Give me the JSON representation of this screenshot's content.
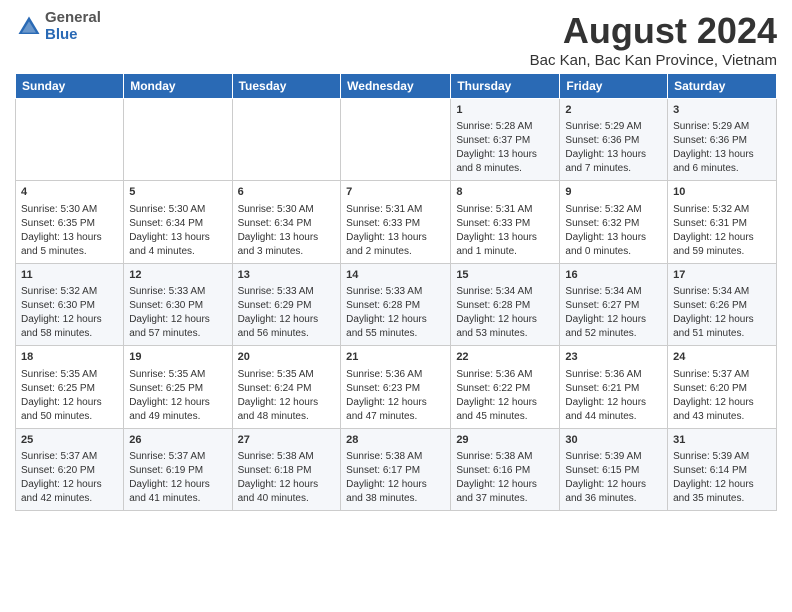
{
  "header": {
    "logo_general": "General",
    "logo_blue": "Blue",
    "title": "August 2024",
    "subtitle": "Bac Kan, Bac Kan Province, Vietnam"
  },
  "days_of_week": [
    "Sunday",
    "Monday",
    "Tuesday",
    "Wednesday",
    "Thursday",
    "Friday",
    "Saturday"
  ],
  "weeks": [
    [
      {
        "day": "",
        "content": ""
      },
      {
        "day": "",
        "content": ""
      },
      {
        "day": "",
        "content": ""
      },
      {
        "day": "",
        "content": ""
      },
      {
        "day": "1",
        "content": "Sunrise: 5:28 AM\nSunset: 6:37 PM\nDaylight: 13 hours\nand 8 minutes."
      },
      {
        "day": "2",
        "content": "Sunrise: 5:29 AM\nSunset: 6:36 PM\nDaylight: 13 hours\nand 7 minutes."
      },
      {
        "day": "3",
        "content": "Sunrise: 5:29 AM\nSunset: 6:36 PM\nDaylight: 13 hours\nand 6 minutes."
      }
    ],
    [
      {
        "day": "4",
        "content": "Sunrise: 5:30 AM\nSunset: 6:35 PM\nDaylight: 13 hours\nand 5 minutes."
      },
      {
        "day": "5",
        "content": "Sunrise: 5:30 AM\nSunset: 6:34 PM\nDaylight: 13 hours\nand 4 minutes."
      },
      {
        "day": "6",
        "content": "Sunrise: 5:30 AM\nSunset: 6:34 PM\nDaylight: 13 hours\nand 3 minutes."
      },
      {
        "day": "7",
        "content": "Sunrise: 5:31 AM\nSunset: 6:33 PM\nDaylight: 13 hours\nand 2 minutes."
      },
      {
        "day": "8",
        "content": "Sunrise: 5:31 AM\nSunset: 6:33 PM\nDaylight: 13 hours\nand 1 minute."
      },
      {
        "day": "9",
        "content": "Sunrise: 5:32 AM\nSunset: 6:32 PM\nDaylight: 13 hours\nand 0 minutes."
      },
      {
        "day": "10",
        "content": "Sunrise: 5:32 AM\nSunset: 6:31 PM\nDaylight: 12 hours\nand 59 minutes."
      }
    ],
    [
      {
        "day": "11",
        "content": "Sunrise: 5:32 AM\nSunset: 6:30 PM\nDaylight: 12 hours\nand 58 minutes."
      },
      {
        "day": "12",
        "content": "Sunrise: 5:33 AM\nSunset: 6:30 PM\nDaylight: 12 hours\nand 57 minutes."
      },
      {
        "day": "13",
        "content": "Sunrise: 5:33 AM\nSunset: 6:29 PM\nDaylight: 12 hours\nand 56 minutes."
      },
      {
        "day": "14",
        "content": "Sunrise: 5:33 AM\nSunset: 6:28 PM\nDaylight: 12 hours\nand 55 minutes."
      },
      {
        "day": "15",
        "content": "Sunrise: 5:34 AM\nSunset: 6:28 PM\nDaylight: 12 hours\nand 53 minutes."
      },
      {
        "day": "16",
        "content": "Sunrise: 5:34 AM\nSunset: 6:27 PM\nDaylight: 12 hours\nand 52 minutes."
      },
      {
        "day": "17",
        "content": "Sunrise: 5:34 AM\nSunset: 6:26 PM\nDaylight: 12 hours\nand 51 minutes."
      }
    ],
    [
      {
        "day": "18",
        "content": "Sunrise: 5:35 AM\nSunset: 6:25 PM\nDaylight: 12 hours\nand 50 minutes."
      },
      {
        "day": "19",
        "content": "Sunrise: 5:35 AM\nSunset: 6:25 PM\nDaylight: 12 hours\nand 49 minutes."
      },
      {
        "day": "20",
        "content": "Sunrise: 5:35 AM\nSunset: 6:24 PM\nDaylight: 12 hours\nand 48 minutes."
      },
      {
        "day": "21",
        "content": "Sunrise: 5:36 AM\nSunset: 6:23 PM\nDaylight: 12 hours\nand 47 minutes."
      },
      {
        "day": "22",
        "content": "Sunrise: 5:36 AM\nSunset: 6:22 PM\nDaylight: 12 hours\nand 45 minutes."
      },
      {
        "day": "23",
        "content": "Sunrise: 5:36 AM\nSunset: 6:21 PM\nDaylight: 12 hours\nand 44 minutes."
      },
      {
        "day": "24",
        "content": "Sunrise: 5:37 AM\nSunset: 6:20 PM\nDaylight: 12 hours\nand 43 minutes."
      }
    ],
    [
      {
        "day": "25",
        "content": "Sunrise: 5:37 AM\nSunset: 6:20 PM\nDaylight: 12 hours\nand 42 minutes."
      },
      {
        "day": "26",
        "content": "Sunrise: 5:37 AM\nSunset: 6:19 PM\nDaylight: 12 hours\nand 41 minutes."
      },
      {
        "day": "27",
        "content": "Sunrise: 5:38 AM\nSunset: 6:18 PM\nDaylight: 12 hours\nand 40 minutes."
      },
      {
        "day": "28",
        "content": "Sunrise: 5:38 AM\nSunset: 6:17 PM\nDaylight: 12 hours\nand 38 minutes."
      },
      {
        "day": "29",
        "content": "Sunrise: 5:38 AM\nSunset: 6:16 PM\nDaylight: 12 hours\nand 37 minutes."
      },
      {
        "day": "30",
        "content": "Sunrise: 5:39 AM\nSunset: 6:15 PM\nDaylight: 12 hours\nand 36 minutes."
      },
      {
        "day": "31",
        "content": "Sunrise: 5:39 AM\nSunset: 6:14 PM\nDaylight: 12 hours\nand 35 minutes."
      }
    ]
  ]
}
